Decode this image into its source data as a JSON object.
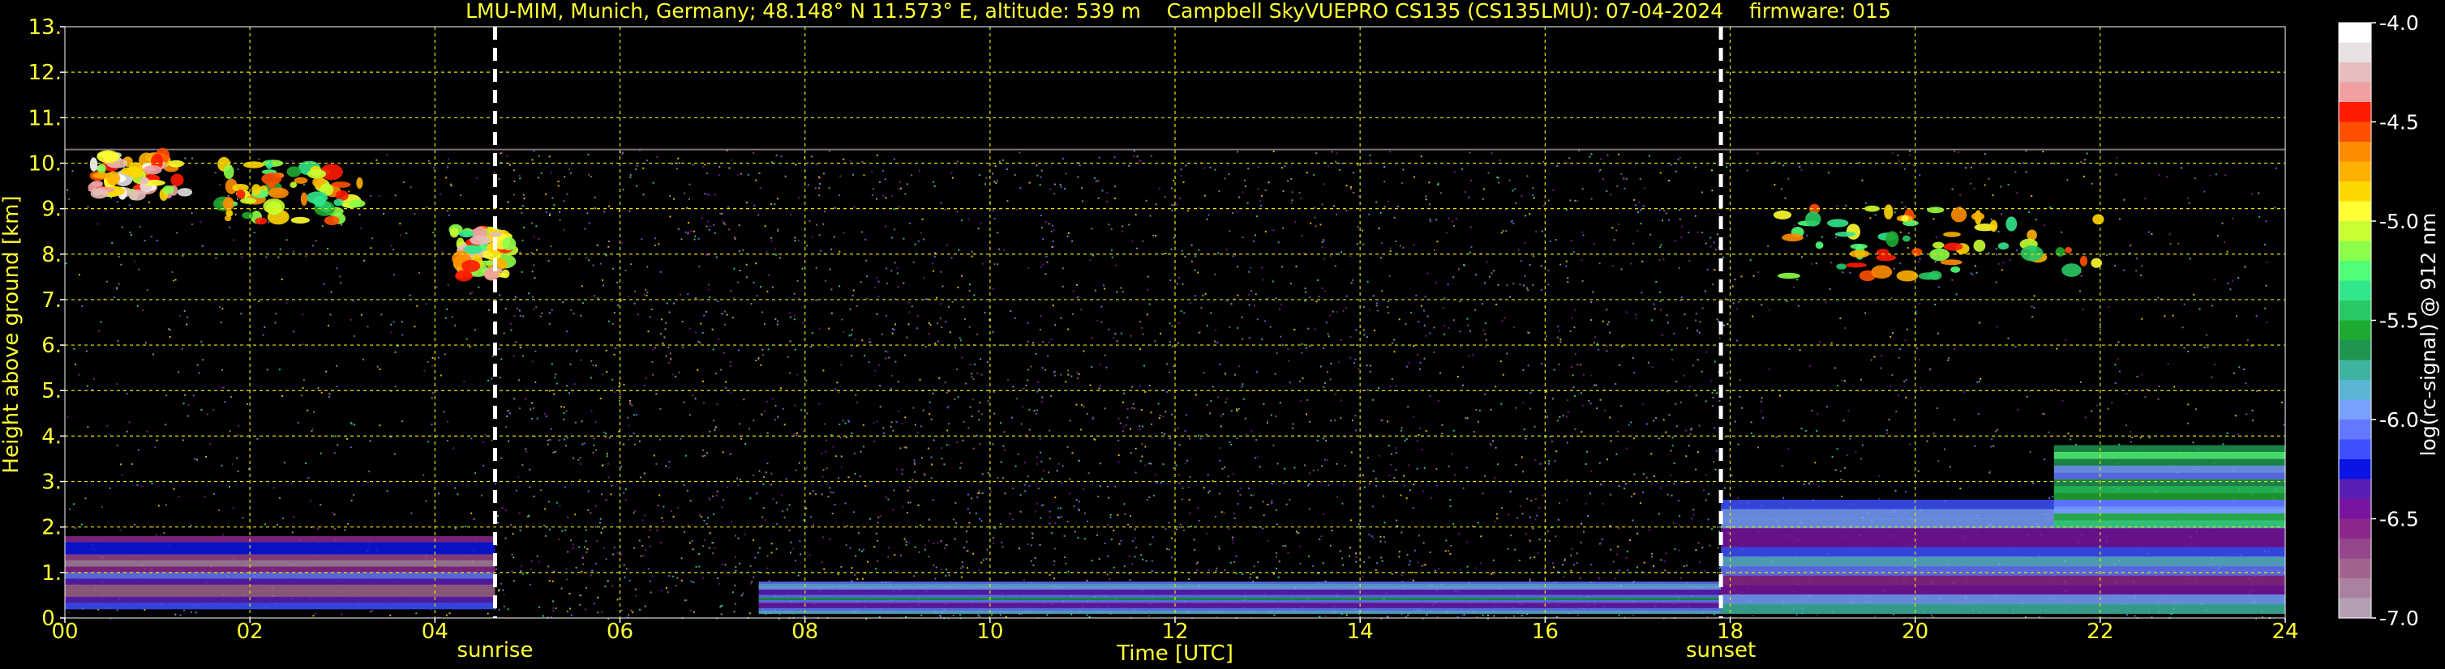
{
  "chart_data": {
    "type": "heatmap",
    "title": "LMU-MIM, Munich, Germany; 48.148° N 11.573° E, altitude: 539 m    Campbell SkyVUEPRO CS135 (CS135LMU): 07-04-2024    firmware: 015",
    "xlabel": "Time [UTC]",
    "ylabel": "Height above ground [km]",
    "xlim": [
      0,
      24
    ],
    "ylim": [
      0,
      13
    ],
    "x_ticks": [
      "00",
      "02",
      "04",
      "06",
      "08",
      "10",
      "12",
      "14",
      "16",
      "18",
      "20",
      "22",
      "24"
    ],
    "y_ticks": [
      "0.",
      "1.",
      "2.",
      "3.",
      "4.",
      "5.",
      "6.",
      "7.",
      "8.",
      "9.",
      "10.",
      "11.",
      "12.",
      "13."
    ],
    "grid": true,
    "data_top_km": 10.3,
    "vertical_markers": [
      {
        "label": "sunrise",
        "x": 4.65
      },
      {
        "label": "sunset",
        "x": 17.9
      }
    ],
    "colorbar": {
      "label": "log(rc-signal) @ 912 nm",
      "range": [
        -7.0,
        -4.0
      ],
      "ticks": [
        "-4.0",
        "-4.5",
        "-5.0",
        "-5.5",
        "-6.0",
        "-6.5",
        "-7.0"
      ],
      "colors": [
        "#ffffff",
        "#e7e1e1",
        "#e7bcbc",
        "#f0a0a0",
        "#ff1a00",
        "#ff5000",
        "#ff8c00",
        "#ffb000",
        "#ffd700",
        "#ffff33",
        "#c8ff32",
        "#8cff4a",
        "#50ff78",
        "#32e68c",
        "#28c864",
        "#1eaa32",
        "#1e9650",
        "#3cb4a0",
        "#5ab4d2",
        "#78a0ff",
        "#6478ff",
        "#3c50ff",
        "#0a14e6",
        "#5a1eb4",
        "#7814a0",
        "#8c288c",
        "#96468c",
        "#a0648c",
        "#aa82a0",
        "#b4a0b4"
      ]
    },
    "features": [
      {
        "name": "cirrus-early",
        "x": [
          0.3,
          1.3
        ],
        "y": [
          9.3,
          10.2
        ],
        "level": -4.6
      },
      {
        "name": "cirrus-early-2",
        "x": [
          1.7,
          3.2
        ],
        "y": [
          8.7,
          10.0
        ],
        "level": -5.0
      },
      {
        "name": "cirrus-sunrise",
        "x": [
          4.2,
          4.8
        ],
        "y": [
          7.5,
          8.6
        ],
        "level": -4.8
      },
      {
        "name": "cirrus-evening",
        "x": [
          18.5,
          22.0
        ],
        "y": [
          7.5,
          9.0
        ],
        "level": -5.0
      },
      {
        "name": "boundary-layer-night",
        "x": [
          0,
          4.65
        ],
        "y": [
          0.2,
          1.8
        ],
        "level": -6.5
      },
      {
        "name": "boundary-layer-day",
        "x": [
          7.5,
          17.9
        ],
        "y": [
          0.1,
          0.8
        ],
        "level": -6.1
      },
      {
        "name": "residual-layer-evening",
        "x": [
          17.9,
          24
        ],
        "y": [
          0.1,
          2.6
        ],
        "level": -6.2
      },
      {
        "name": "aerosol-layer-late",
        "x": [
          21.5,
          24
        ],
        "y": [
          2.0,
          3.8
        ],
        "level": -5.7
      }
    ]
  }
}
